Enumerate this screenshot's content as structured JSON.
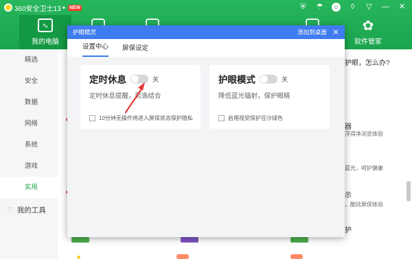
{
  "app": {
    "title": "360安全卫士13",
    "new_badge": "NEW",
    "accent_color": "#1aa44e",
    "top_icons": [
      "shield-icon",
      "umbrella-icon",
      "avatar-icon",
      "skin-icon",
      "menu-icon",
      "minimize-icon",
      "close-icon"
    ]
  },
  "nav": {
    "my_computer": "我的电脑",
    "software_manager": "软件管家"
  },
  "sidebar": {
    "items": [
      "精选",
      "安全",
      "数据",
      "网络",
      "系统",
      "游戏",
      "实用"
    ],
    "active": "实用",
    "my_tools": "我的工具"
  },
  "background": {
    "question": "护眼，怎么办?",
    "frag1": "器",
    "frag1_desc": "浮得净浏览体验",
    "frag2_desc": "蓝光，呵护健康",
    "frag3": "示",
    "frag3_desc": "，酷炫屏保体验",
    "frag4": "护"
  },
  "dialog": {
    "title": "护眼精灵",
    "add_to_desktop": "添加到桌面",
    "tabs": [
      "设置中心",
      "屏保设定"
    ],
    "active_tab": "设置中心",
    "dialog_accent": "#3f7cf0",
    "cards": [
      {
        "title": "定时休息",
        "toggle_state": "关",
        "toggle_on": false,
        "description": "定时休息提醒，劳逸结合",
        "checkbox_label": "10分钟无操作将进入屏保状态保护隐私",
        "checked": false
      },
      {
        "title": "护眼模式",
        "toggle_state": "关",
        "toggle_on": false,
        "description": "降低蓝光辐射，保护眼睛",
        "checkbox_label": "启用视觉保护豆沙绿色",
        "checked": false
      }
    ]
  }
}
